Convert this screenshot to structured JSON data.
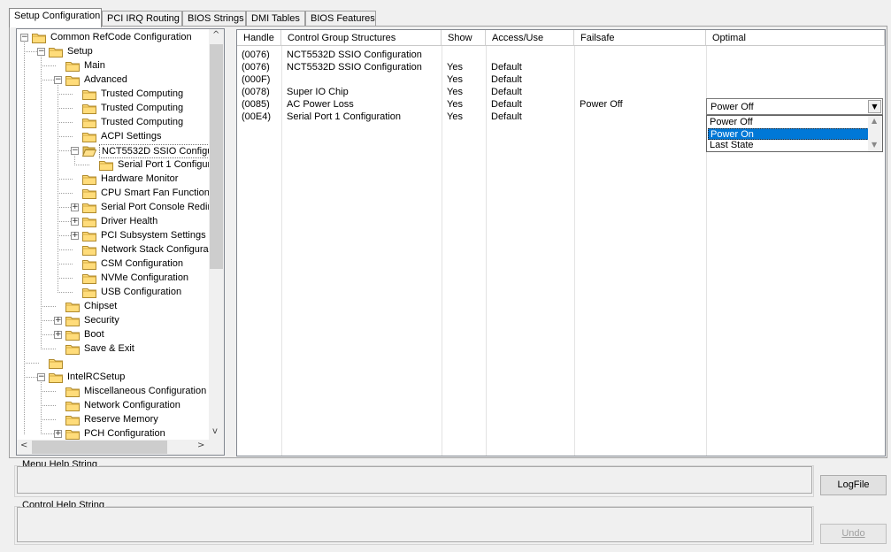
{
  "tabs": [
    {
      "label": "Setup Configuration",
      "active": true
    },
    {
      "label": "PCI IRQ Routing",
      "active": false
    },
    {
      "label": "BIOS Strings",
      "active": false
    },
    {
      "label": "DMI Tables",
      "active": false
    },
    {
      "label": "BIOS Features",
      "active": false
    }
  ],
  "tree": {
    "nodes": [
      {
        "label": "Common RefCode Configuration",
        "expander": "minus"
      },
      {
        "label": "Setup",
        "expander": "minus"
      },
      {
        "label": "Main",
        "expander": ""
      },
      {
        "label": "Advanced",
        "expander": "minus"
      },
      {
        "label": "Trusted Computing",
        "expander": ""
      },
      {
        "label": "Trusted Computing",
        "expander": ""
      },
      {
        "label": "Trusted Computing",
        "expander": ""
      },
      {
        "label": "ACPI Settings",
        "expander": ""
      },
      {
        "label": "NCT5532D SSIO Configu",
        "expander": "minus",
        "selected": true,
        "open": true
      },
      {
        "label": "Serial Port 1 Configura",
        "expander": ""
      },
      {
        "label": "Hardware Monitor",
        "expander": ""
      },
      {
        "label": "CPU Smart Fan Function",
        "expander": ""
      },
      {
        "label": "Serial Port Console Redire",
        "expander": "plus"
      },
      {
        "label": "Driver Health",
        "expander": "plus"
      },
      {
        "label": "PCI Subsystem Settings",
        "expander": "plus"
      },
      {
        "label": "Network Stack Configura",
        "expander": ""
      },
      {
        "label": "CSM Configuration",
        "expander": ""
      },
      {
        "label": "NVMe Configuration",
        "expander": ""
      },
      {
        "label": "USB Configuration",
        "expander": ""
      },
      {
        "label": "Chipset",
        "expander": ""
      },
      {
        "label": "Security",
        "expander": "plus"
      },
      {
        "label": "Boot",
        "expander": "plus"
      },
      {
        "label": "Save & Exit",
        "expander": ""
      },
      {
        "label": "",
        "expander": ""
      },
      {
        "label": "IntelRCSetup",
        "expander": "minus"
      },
      {
        "label": "Miscellaneous Configuration",
        "expander": ""
      },
      {
        "label": "Network Configuration",
        "expander": ""
      },
      {
        "label": "Reserve Memory",
        "expander": ""
      },
      {
        "label": "PCH Configuration",
        "expander": "plus"
      }
    ],
    "scroll_up": "^",
    "scroll_down": "v",
    "scroll_left": "<",
    "scroll_right": ">"
  },
  "grid": {
    "columns": [
      "Handle",
      "Control Group Structures",
      "Show",
      "Access/Use",
      "Failsafe",
      "Optimal"
    ],
    "rows": [
      [
        "(0076)",
        "NCT5532D SSIO Configuration",
        "",
        "",
        "",
        ""
      ],
      [
        "(0076)",
        "NCT5532D SSIO Configuration",
        "Yes",
        "Default",
        "",
        ""
      ],
      [
        "(000F)",
        "",
        "Yes",
        "Default",
        "",
        ""
      ],
      [
        "(0078)",
        "Super IO Chip",
        "Yes",
        "Default",
        "",
        ""
      ],
      [
        "(0085)",
        "AC Power Loss",
        "Yes",
        "Default",
        "Power Off",
        ""
      ],
      [
        "(00E4)",
        "Serial Port 1 Configuration",
        "Yes",
        "Default",
        "",
        ""
      ]
    ]
  },
  "optimal_combo": {
    "value": "Power Off",
    "arrow": "▼",
    "options": [
      "Power Off",
      "Power On",
      "Last State"
    ],
    "highlighted": "Power On"
  },
  "menu_help": {
    "title": "Menu Help String",
    "text": ""
  },
  "control_help": {
    "title": "Control Help String",
    "text": ""
  },
  "buttons": {
    "logfile": "LogFile",
    "undo": "Undo"
  }
}
